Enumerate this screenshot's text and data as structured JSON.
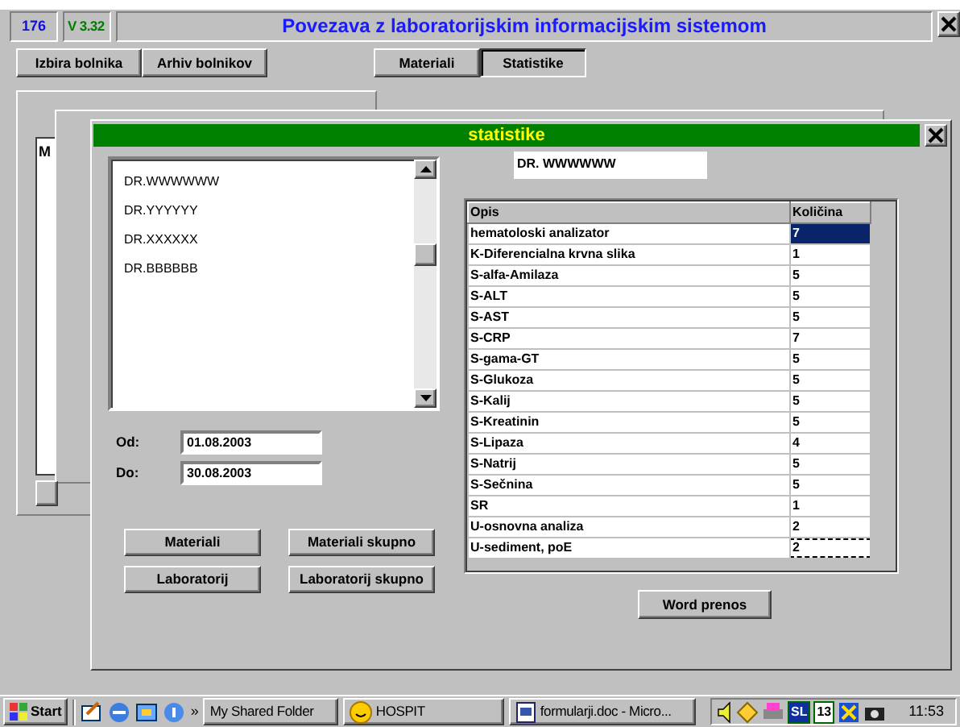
{
  "header": {
    "counter": "176",
    "version": "V 3.32",
    "title": "Povezava z laboratorijskim informacijskim sistemom"
  },
  "toolbar_left": [
    {
      "label": "Izbira bolnika",
      "selected": false
    },
    {
      "label": "Arhiv bolnikov",
      "selected": false
    }
  ],
  "tabs": [
    {
      "label": "Materiali",
      "selected": false
    },
    {
      "label": "Statistike",
      "selected": true
    }
  ],
  "background_window": {
    "label": "M"
  },
  "dialog": {
    "title": "statistike",
    "doctors": [
      {
        "name": "DR.WWWWWW",
        "selected": false
      },
      {
        "name": "DR.YYYYYY",
        "selected": false
      },
      {
        "name": "DR.XXXXXX",
        "selected": false
      },
      {
        "name": "DR.BBBBBB",
        "selected": false
      }
    ],
    "date_from": {
      "label": "Od:",
      "value": "01.08.2003"
    },
    "date_to": {
      "label": "Do:",
      "value": "30.08.2003"
    },
    "buttons": [
      "Materiali",
      "Materiali skupno",
      "Laboratorij",
      "Laboratorij skupno"
    ],
    "doctor_field": "DR. WWWWWW",
    "table": {
      "columns": [
        "Opis",
        "Količina"
      ],
      "rows": [
        {
          "cells": [
            "hematoloski analizator",
            "7"
          ],
          "selected": true,
          "focused": false
        },
        {
          "cells": [
            "K-Diferencialna krvna slika",
            "1"
          ],
          "selected": false,
          "focused": false
        },
        {
          "cells": [
            "S-alfa-Amilaza",
            "5"
          ],
          "selected": false,
          "focused": false
        },
        {
          "cells": [
            "S-ALT",
            "5"
          ],
          "selected": false,
          "focused": false
        },
        {
          "cells": [
            "S-AST",
            "5"
          ],
          "selected": false,
          "focused": false
        },
        {
          "cells": [
            "S-CRP",
            "7"
          ],
          "selected": false,
          "focused": false
        },
        {
          "cells": [
            "S-gama-GT",
            "5"
          ],
          "selected": false,
          "focused": false
        },
        {
          "cells": [
            "S-Glukoza",
            "5"
          ],
          "selected": false,
          "focused": false
        },
        {
          "cells": [
            "S-Kalij",
            "5"
          ],
          "selected": false,
          "focused": false
        },
        {
          "cells": [
            "S-Kreatinin",
            "5"
          ],
          "selected": false,
          "focused": false
        },
        {
          "cells": [
            "S-Lipaza",
            "4"
          ],
          "selected": false,
          "focused": false
        },
        {
          "cells": [
            "S-Natrij",
            "5"
          ],
          "selected": false,
          "focused": false
        },
        {
          "cells": [
            "S-Sečnina",
            "5"
          ],
          "selected": false,
          "focused": false
        },
        {
          "cells": [
            "SR",
            "1"
          ],
          "selected": false,
          "focused": false
        },
        {
          "cells": [
            "U-osnovna analiza",
            "2"
          ],
          "selected": false,
          "focused": false
        },
        {
          "cells": [
            "U-sediment, poE",
            "2"
          ],
          "selected": false,
          "focused": true
        }
      ]
    },
    "export_button": "Word prenos"
  },
  "taskbar": {
    "start": "Start",
    "more": "»",
    "tasks": [
      {
        "label": "My Shared Folder",
        "kind": "plain"
      },
      {
        "label": "HOSPIT",
        "kind": "smiley"
      },
      {
        "label": "formularji.doc - Micro...",
        "kind": "document"
      }
    ],
    "tray_labels": [
      "SL",
      "13"
    ],
    "clock": "11:53"
  }
}
